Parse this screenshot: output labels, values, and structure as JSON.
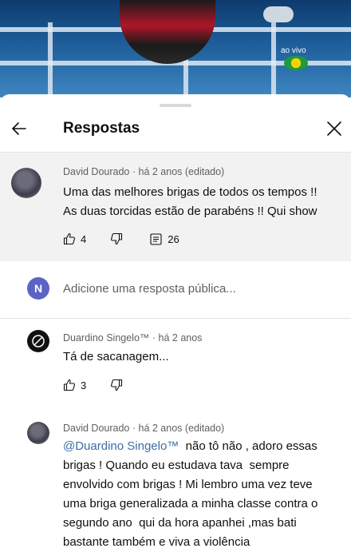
{
  "video": {
    "live_label": "ao vivo"
  },
  "header": {
    "title": "Respostas"
  },
  "parent_comment": {
    "author": "David Dourado",
    "meta": " · há 2 anos (editado)",
    "lines": [
      "Uma das melhores brigas de todos os tempos !!",
      "As duas torcidas estão de parabéns !! Qui show"
    ],
    "likes": "4",
    "replies": "26"
  },
  "add_reply": {
    "avatar_letter": "N",
    "placeholder": "Adicione uma resposta pública..."
  },
  "reply1": {
    "author": "Duardino Singelo™",
    "meta": " · há 2 anos",
    "text": "Tá de sacanagem...",
    "likes": "3"
  },
  "reply2": {
    "author": "David Dourado",
    "meta": " · há 2 anos (editado)",
    "mention": "@Duardino Singelo™",
    "line1_rest": "  não tô não , adoro essas",
    "lines": [
      "brigas ! Quando eu estudava tava  sempre",
      "envolvido com brigas ! Mi lembro uma vez teve",
      "uma briga generalizada a minha classe contra o",
      "segundo ano  qui da hora apanhei ,mas bati",
      "bastante também e viva a violência"
    ]
  },
  "colors": {
    "accent_mention": "#3c6ea6",
    "n_avatar": "#5b63c5",
    "parent_bg": "#f2f2f2"
  }
}
